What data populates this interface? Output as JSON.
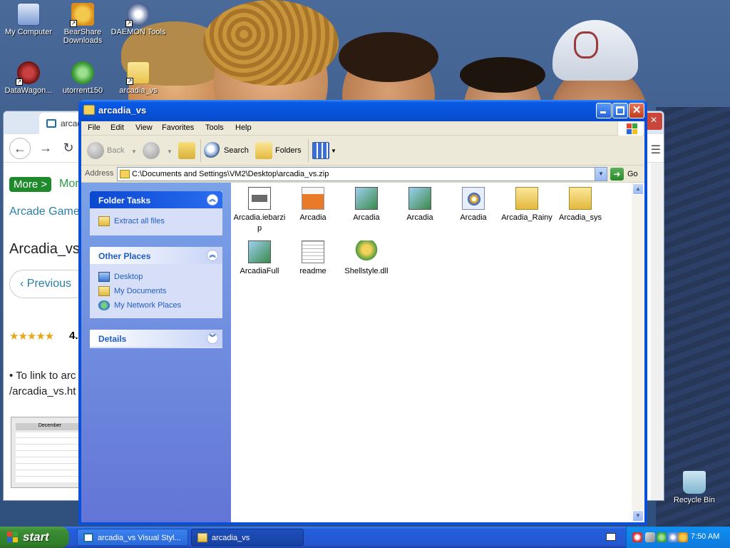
{
  "desktop": {
    "icons": [
      {
        "label": "My Computer",
        "icon": "my-computer-icon"
      },
      {
        "label": "BearShare Downloads",
        "icon": "bearshare-downloads-icon"
      },
      {
        "label": "DAEMON Tools",
        "icon": "daemon-tools-icon"
      },
      {
        "label": "DataWagon...",
        "icon": "datawagon-icon"
      },
      {
        "label": "utorrent150",
        "icon": "utorrent-icon"
      },
      {
        "label": "arcadia_vs",
        "icon": "zip-folder-icon"
      },
      {
        "label": "Recycle Bin",
        "icon": "recycle-bin-icon"
      }
    ]
  },
  "background_window": {
    "tab_label": "arcadia",
    "more_button": "More >",
    "more_link": "Mor",
    "breadcrumb": "Arcade Game",
    "page_heading": "Arcadia_vs",
    "previous_button": "Previous",
    "rating_stars": "★★★★★",
    "rating_value": "4.",
    "link_line1": "• To link to arc",
    "link_line2": "/arcadia_vs.ht",
    "calendar_month": "December",
    "nav_back": "←",
    "nav_forward": "→",
    "nav_reload": "↻"
  },
  "explorer": {
    "title": "arcadia_vs",
    "menu": [
      "File",
      "Edit",
      "View",
      "Favorites",
      "Tools",
      "Help"
    ],
    "toolbar": {
      "back_label": "Back",
      "search_label": "Search",
      "folders_label": "Folders"
    },
    "address": {
      "label": "Address",
      "value": "C:\\Documents and Settings\\VM2\\Desktop\\arcadia_vs.zip",
      "go_label": "Go"
    },
    "tasks": {
      "folder_tasks": {
        "title": "Folder Tasks",
        "items": [
          {
            "label": "Extract all files",
            "icon": "extract-zip-icon"
          }
        ]
      },
      "other_places": {
        "title": "Other Places",
        "items": [
          {
            "label": "Desktop",
            "icon": "desktop-icon"
          },
          {
            "label": "My Documents",
            "icon": "my-documents-icon"
          },
          {
            "label": "My Network Places",
            "icon": "network-places-icon"
          }
        ]
      },
      "details": {
        "title": "Details"
      }
    },
    "files": [
      {
        "name": "Arcadia.iebarzip",
        "icon": "bitmap-file-icon"
      },
      {
        "name": "Arcadia",
        "icon": "theme-file-icon"
      },
      {
        "name": "Arcadia",
        "icon": "image-file-icon"
      },
      {
        "name": "Arcadia",
        "icon": "image-file-icon"
      },
      {
        "name": "Arcadia",
        "icon": "media-file-icon"
      },
      {
        "name": "Arcadia_Rainy",
        "icon": "zip-folder-icon"
      },
      {
        "name": "Arcadia_sys",
        "icon": "zip-folder-icon"
      },
      {
        "name": "ArcadiaFull",
        "icon": "image-file-icon"
      },
      {
        "name": "readme",
        "icon": "text-file-icon"
      },
      {
        "name": "Shellstyle.dll",
        "icon": "dll-file-icon"
      }
    ]
  },
  "taskbar": {
    "start_label": "start",
    "tasks": [
      {
        "label": "arcadia_vs Visual Styl...",
        "icon": "browser-icon"
      },
      {
        "label": "arcadia_vs",
        "icon": "zip-folder-icon"
      }
    ],
    "clock": "7:50 AM"
  },
  "colors": {
    "xp_blue": "#0a4fd7",
    "task_pane": "#6375d6",
    "start_green": "#3c8d36"
  }
}
